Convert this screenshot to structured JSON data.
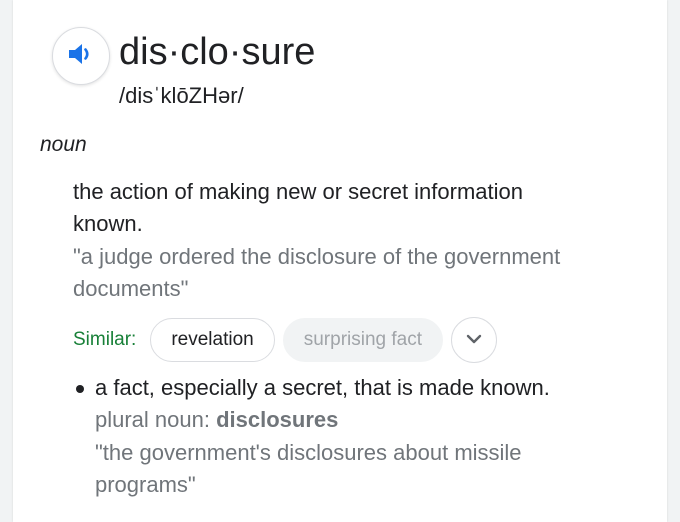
{
  "entry": {
    "word": "dis·clo·sure",
    "phonetic": "/disˈklōZHər/",
    "part_of_speech": "noun"
  },
  "sense1": {
    "definition": "the action of making new or secret information known.",
    "example": "\"a judge ordered the disclosure of the government documents\""
  },
  "similar": {
    "label": "Similar:",
    "chips": [
      "revelation",
      "surprising fact"
    ]
  },
  "sense2": {
    "definition": "a fact, especially a secret, that is made known.",
    "plural_label": "plural noun: ",
    "plural_value": "disclosures",
    "example": "\"the government's disclosures about missile programs\""
  },
  "icons": {
    "speaker": "speaker-icon",
    "expand": "chevron-down-icon"
  },
  "colors": {
    "accent_blue": "#1a73e8",
    "similar_green": "#188038",
    "muted_text": "#70757a"
  }
}
